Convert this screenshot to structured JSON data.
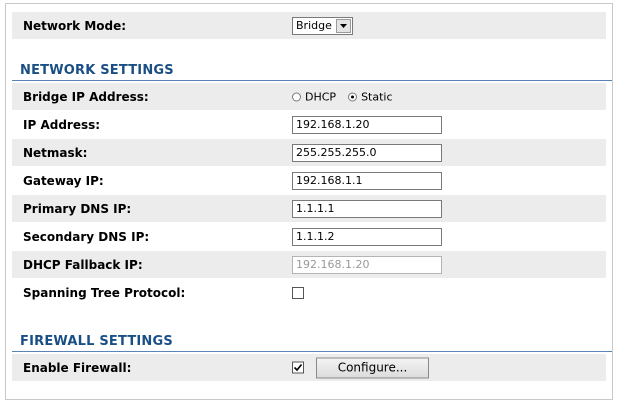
{
  "network_mode": {
    "label": "Network Mode:",
    "value": "Bridge"
  },
  "network_settings": {
    "title": "NETWORK SETTINGS",
    "bridge_ip": {
      "label": "Bridge IP Address:",
      "options": [
        "DHCP",
        "Static"
      ],
      "selected": "Static"
    },
    "ip_address": {
      "label": "IP Address:",
      "value": "192.168.1.20"
    },
    "netmask": {
      "label": "Netmask:",
      "value": "255.255.255.0"
    },
    "gateway": {
      "label": "Gateway IP:",
      "value": "192.168.1.1"
    },
    "primary_dns": {
      "label": "Primary DNS IP:",
      "value": "1.1.1.1"
    },
    "secondary_dns": {
      "label": "Secondary DNS IP:",
      "value": "1.1.1.2"
    },
    "dhcp_fallback": {
      "label": "DHCP Fallback IP:",
      "value": "192.168.1.20",
      "disabled": true
    },
    "stp": {
      "label": "Spanning Tree Protocol:",
      "checked": false
    }
  },
  "firewall_settings": {
    "title": "FIREWALL SETTINGS",
    "enable": {
      "label": "Enable Firewall:",
      "checked": true
    },
    "configure_label": "Configure..."
  },
  "colors": {
    "section_title": "#1a4f86",
    "section_rule": "#5a84b5",
    "row_shade": "#ececec"
  }
}
